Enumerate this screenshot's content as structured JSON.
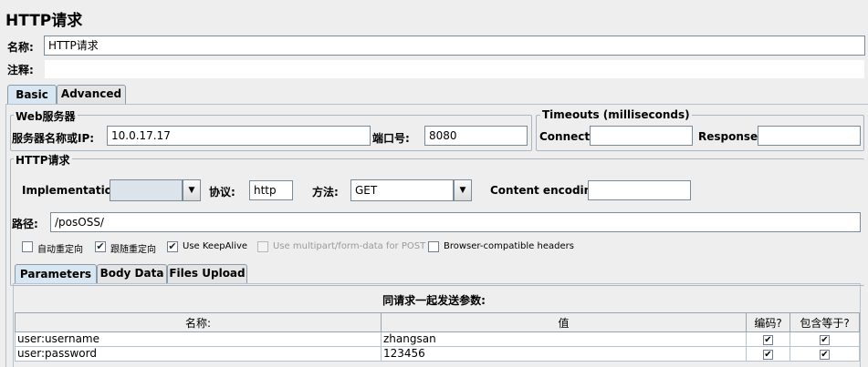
{
  "title": "HTTP请求",
  "name_label": "名称:",
  "name_value": "HTTP请求",
  "comment_label": "注释:",
  "comment_value": "",
  "tabs": {
    "basic": "Basic",
    "advanced": "Advanced"
  },
  "web_server": {
    "group_title": "Web服务器",
    "server_label": "服务器名称或IP:",
    "server_value": "10.0.17.17",
    "port_label": "端口号:",
    "port_value": "8080"
  },
  "timeouts": {
    "group_title": "Timeouts (milliseconds)",
    "connect_label": "Connect:",
    "connect_value": "",
    "response_label": "Response:",
    "response_value": ""
  },
  "http_request": {
    "group_title": "HTTP请求",
    "implementation_label": "Implementation:",
    "implementation_value": "",
    "protocol_label": "协议:",
    "protocol_value": "http",
    "method_label": "方法:",
    "method_value": "GET",
    "encoding_label": "Content encoding:",
    "encoding_value": "",
    "path_label": "路径:",
    "path_value": "/posOSS/"
  },
  "options": [
    {
      "label": "自动重定向",
      "checked": false,
      "disabled": false
    },
    {
      "label": "跟随重定向",
      "checked": true,
      "disabled": false
    },
    {
      "label": "Use KeepAlive",
      "checked": true,
      "disabled": false
    },
    {
      "label": "Use multipart/form-data for POST",
      "checked": false,
      "disabled": true
    },
    {
      "label": "Browser-compatible headers",
      "checked": false,
      "disabled": false
    }
  ],
  "sub_tabs": {
    "parameters": "Parameters",
    "body_data": "Body Data",
    "files_upload": "Files Upload"
  },
  "params": {
    "caption": "同请求一起发送参数:",
    "headers": [
      "名称:",
      "值",
      "编码?",
      "包含等于?"
    ],
    "rows": [
      {
        "name": "user:username",
        "value": "zhangsan",
        "encode": true,
        "include_equals": true
      },
      {
        "name": "user:password",
        "value": "123456",
        "encode": true,
        "include_equals": true
      }
    ]
  },
  "check_glyph": "✔",
  "dropdown_glyph": "▼"
}
